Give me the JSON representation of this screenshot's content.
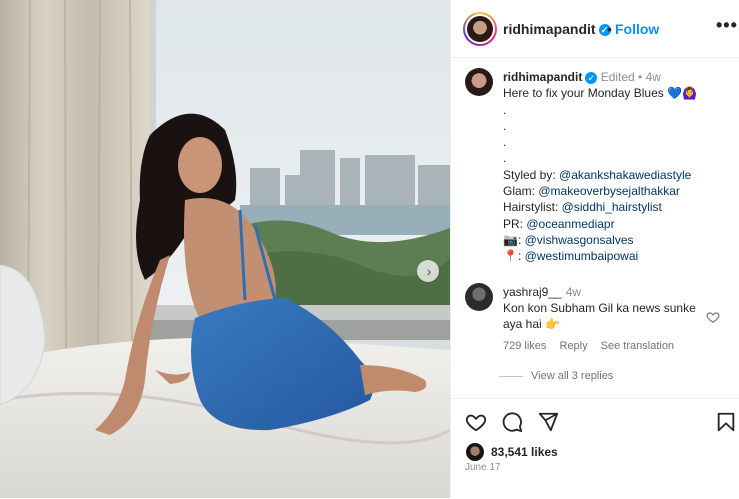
{
  "header": {
    "username": "ridhimapandit",
    "separator": "•",
    "follow_label": "Follow",
    "more_label": "•••"
  },
  "caption": {
    "username": "ridhimapandit",
    "meta": "Edited • 4w",
    "lines": [
      {
        "text": "Here to fix your Monday Blues 💙🙆‍♀️"
      },
      {
        "text": "."
      },
      {
        "text": "."
      },
      {
        "text": "."
      },
      {
        "text": "."
      },
      {
        "prefix": "Styled by: ",
        "mention": "@akankshakawediastyle"
      },
      {
        "prefix": "Glam: ",
        "mention": "@makeoverbysejalthakkar"
      },
      {
        "prefix": "Hairstylist: ",
        "mention": "@siddhi_hairstylist"
      },
      {
        "prefix": "PR: ",
        "mention": "@oceanmediapr"
      },
      {
        "prefix": "📷: ",
        "mention": "@vishwasgonsalves"
      },
      {
        "prefix": "📍: ",
        "mention": "@westimumbaipowai"
      }
    ]
  },
  "comment": {
    "username": "yashraj9__",
    "time": "4w",
    "text": "Kon kon Subham Gil ka news sunke aya hai 👉",
    "likes": "729 likes",
    "reply": "Reply",
    "translate": "See translation",
    "view_replies": "View all 3 replies"
  },
  "footer": {
    "likes": "83,541 likes",
    "date": "June 17"
  },
  "icons": {
    "next": "chevron-right-icon",
    "verified": "verified-badge-icon",
    "like": "heart-icon",
    "comment": "comment-icon",
    "share": "send-icon",
    "save": "bookmark-icon"
  },
  "colors": {
    "accent": "#0095f6",
    "mention": "#00376b",
    "muted": "#8e8e8e",
    "dress": "#2f6fb0"
  }
}
